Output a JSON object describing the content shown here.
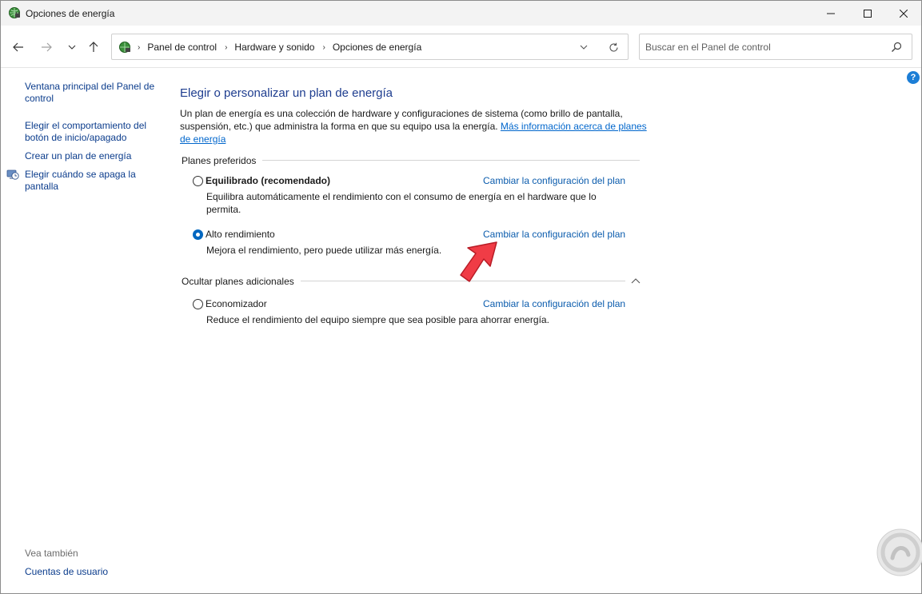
{
  "window": {
    "title": "Opciones de energía"
  },
  "nav": {
    "breadcrumbs": [
      "Panel de control",
      "Hardware y sonido",
      "Opciones de energía"
    ],
    "search_placeholder": "Buscar en el Panel de control"
  },
  "sidebar": {
    "links": [
      {
        "label": "Ventana principal del Panel de control"
      },
      {
        "label": "Elegir el comportamiento del botón de inicio/apagado"
      },
      {
        "label": "Crear un plan de energía"
      },
      {
        "label": "Elegir cuándo se apaga la pantalla"
      }
    ],
    "see_also_label": "Vea también",
    "see_also_links": [
      {
        "label": "Cuentas de usuario"
      }
    ]
  },
  "main": {
    "title": "Elegir o personalizar un plan de energía",
    "intro_text": "Un plan de energía es una colección de hardware y configuraciones de sistema (como brillo de pantalla, suspensión, etc.) que administra la forma en que su equipo usa la energía. ",
    "intro_link": "Más información acerca de planes de energía",
    "preferred_header": "Planes preferidos",
    "additional_header": "Ocultar planes adicionales",
    "plans": [
      {
        "name": "Equilibrado (recomendado)",
        "description": "Equilibra automáticamente el rendimiento con el consumo de energía en el hardware que lo permita.",
        "link": "Cambiar la configuración del plan",
        "selected": false
      },
      {
        "name": "Alto rendimiento",
        "description": "Mejora el rendimiento, pero puede utilizar más energía.",
        "link": "Cambiar la configuración del plan",
        "selected": true
      },
      {
        "name": "Economizador",
        "description": "Reduce el rendimiento del equipo siempre que sea posible para ahorrar energía.",
        "link": "Cambiar la configuración del plan",
        "selected": false
      }
    ]
  },
  "colors": {
    "link": "#0b5cad",
    "title": "#1e3d8f",
    "radio_selected": "#0067c0",
    "annotation_arrow": "#f03c46"
  }
}
